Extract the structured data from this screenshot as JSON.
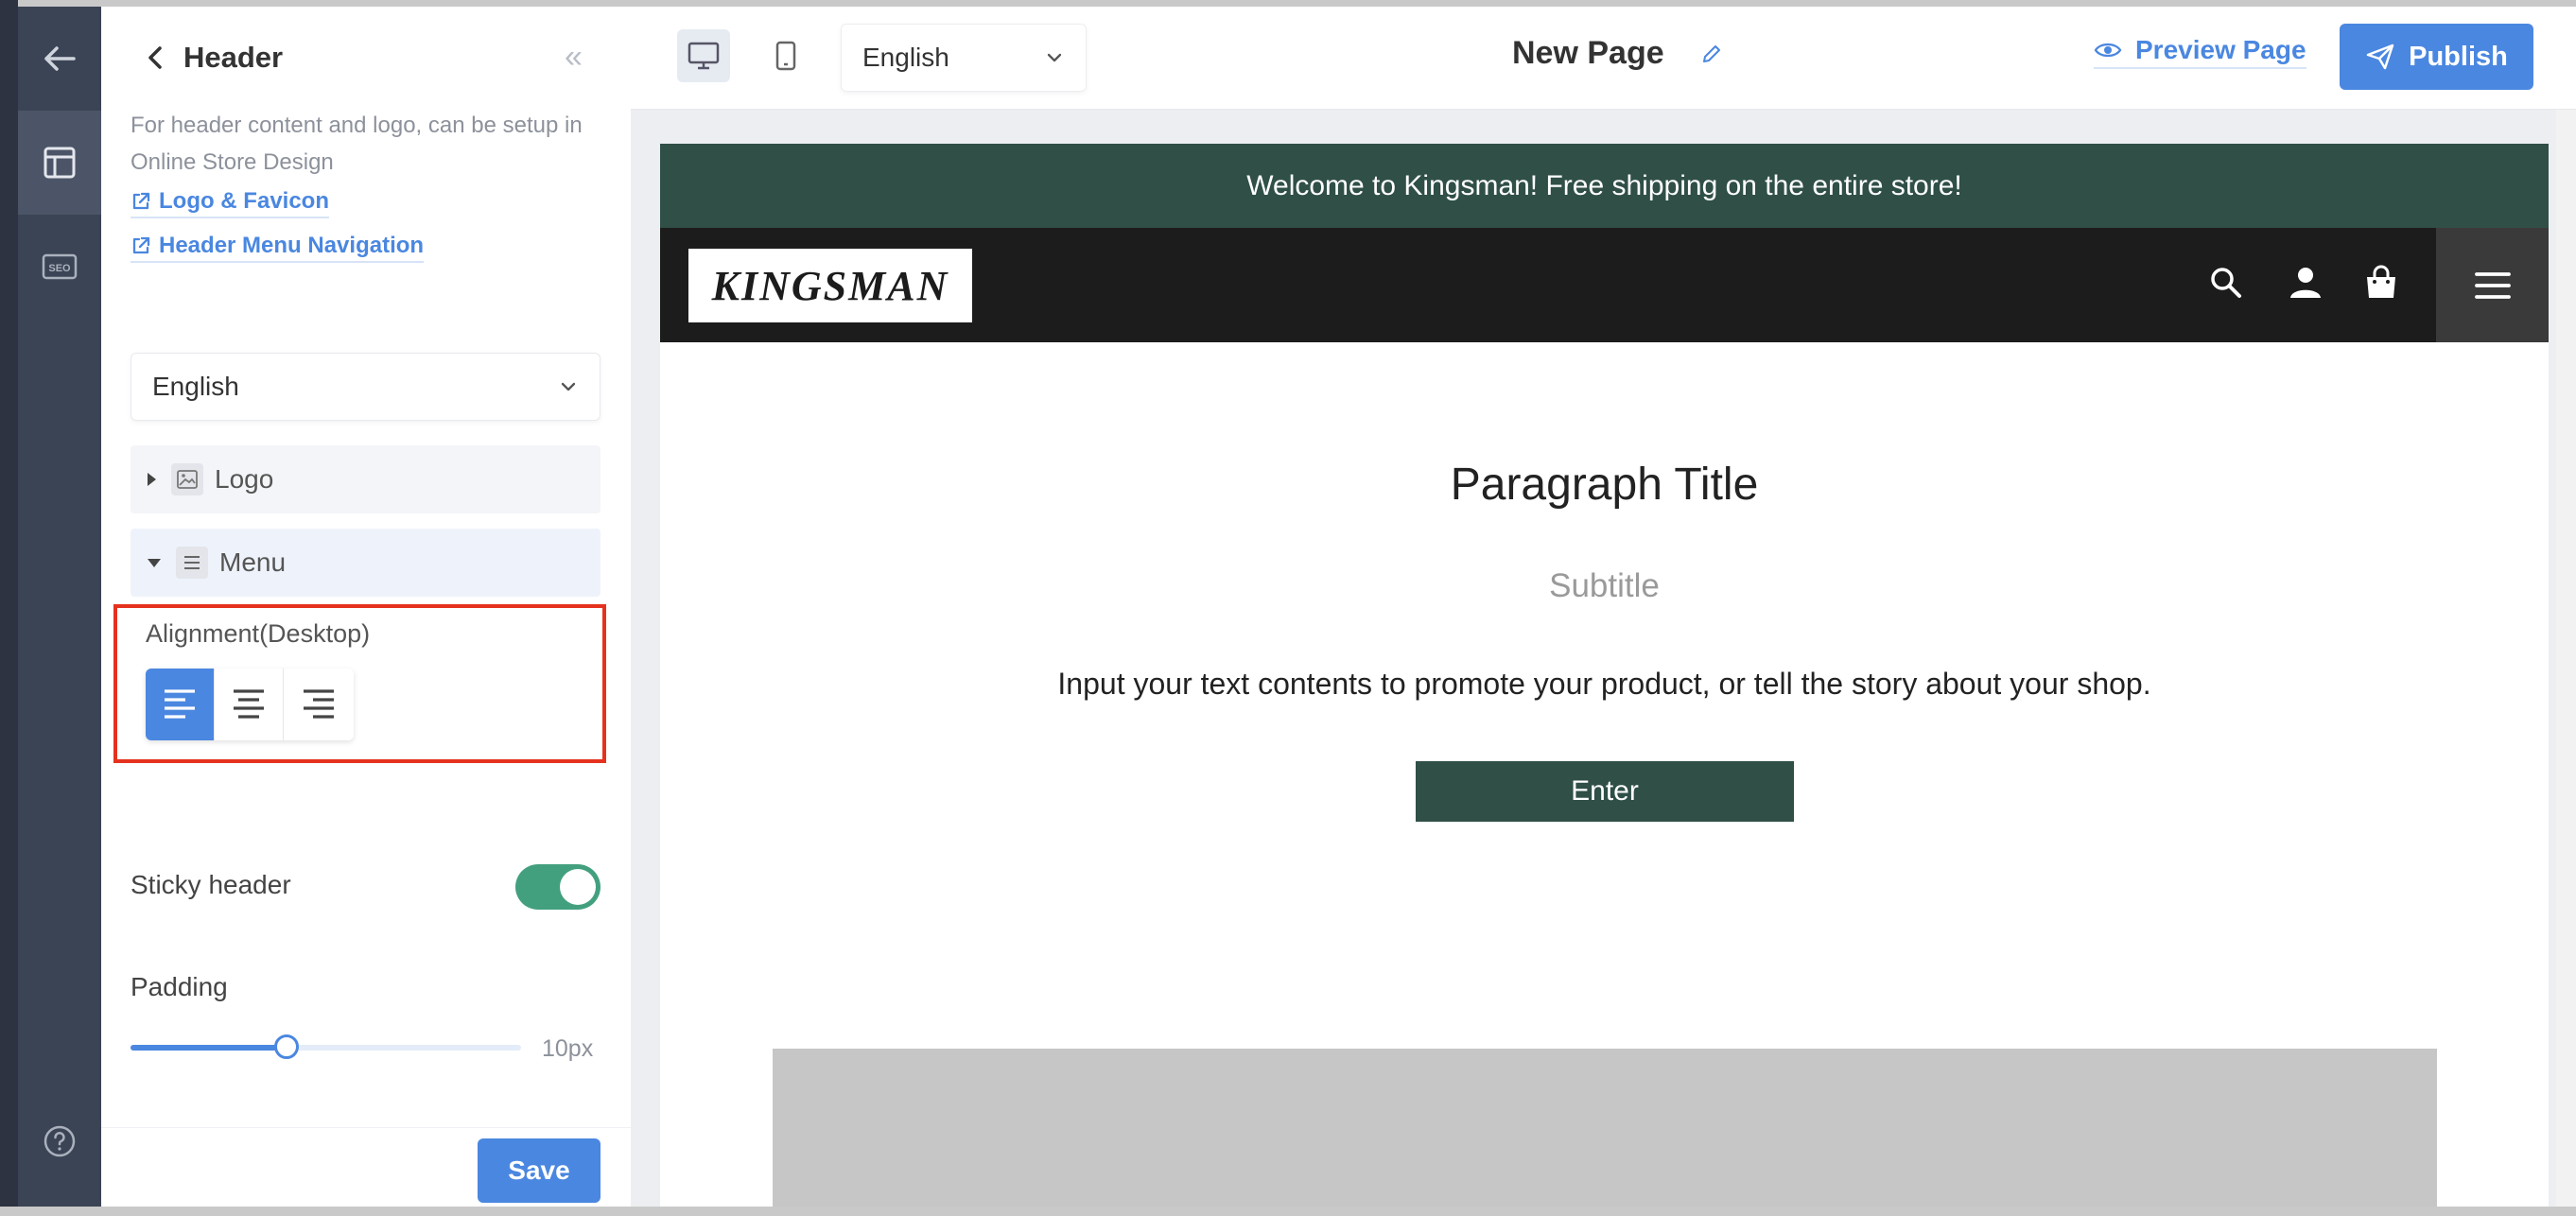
{
  "rail": {
    "items": [
      {
        "name": "back-arrow-icon"
      },
      {
        "name": "layout-icon",
        "active": true
      },
      {
        "name": "seo-icon",
        "label": "SEO"
      },
      {
        "name": "help-icon"
      }
    ]
  },
  "panel": {
    "title": "Header",
    "collapse_glyph": "«",
    "description": "For header content and logo, can be setup in Online Store Design",
    "links": [
      "Logo & Favicon",
      "Header Menu Navigation"
    ],
    "language": "English",
    "sections": [
      {
        "label": "Logo",
        "open": false
      },
      {
        "label": "Menu",
        "open": true
      }
    ],
    "alignment_label": "Alignment(Desktop)",
    "alignment_options": [
      "left",
      "center",
      "right"
    ],
    "alignment_selected": "left",
    "sticky_label": "Sticky header",
    "sticky_on": true,
    "padding_label": "Padding",
    "padding_value": "10px",
    "padding_fraction": 0.4,
    "save_label": "Save"
  },
  "toolbar": {
    "devices": [
      "desktop",
      "mobile"
    ],
    "device_selected": "desktop",
    "language": "English",
    "page_title": "New Page",
    "preview_label": "Preview Page",
    "publish_label": "Publish"
  },
  "preview": {
    "announcement": "Welcome to Kingsman! Free shipping on the entire store!",
    "logo_text": "KINGSMAN",
    "paragraph_title": "Paragraph Title",
    "subtitle": "Subtitle",
    "body": "Input your text contents to promote your product, or tell the story about your shop.",
    "button_label": "Enter"
  },
  "colors": {
    "accent": "#4a87e0",
    "announce_bg": "#2f4f47",
    "header_bg": "#1c1c1c",
    "toggle_on": "#43a07e",
    "highlight": "#e5321e"
  }
}
